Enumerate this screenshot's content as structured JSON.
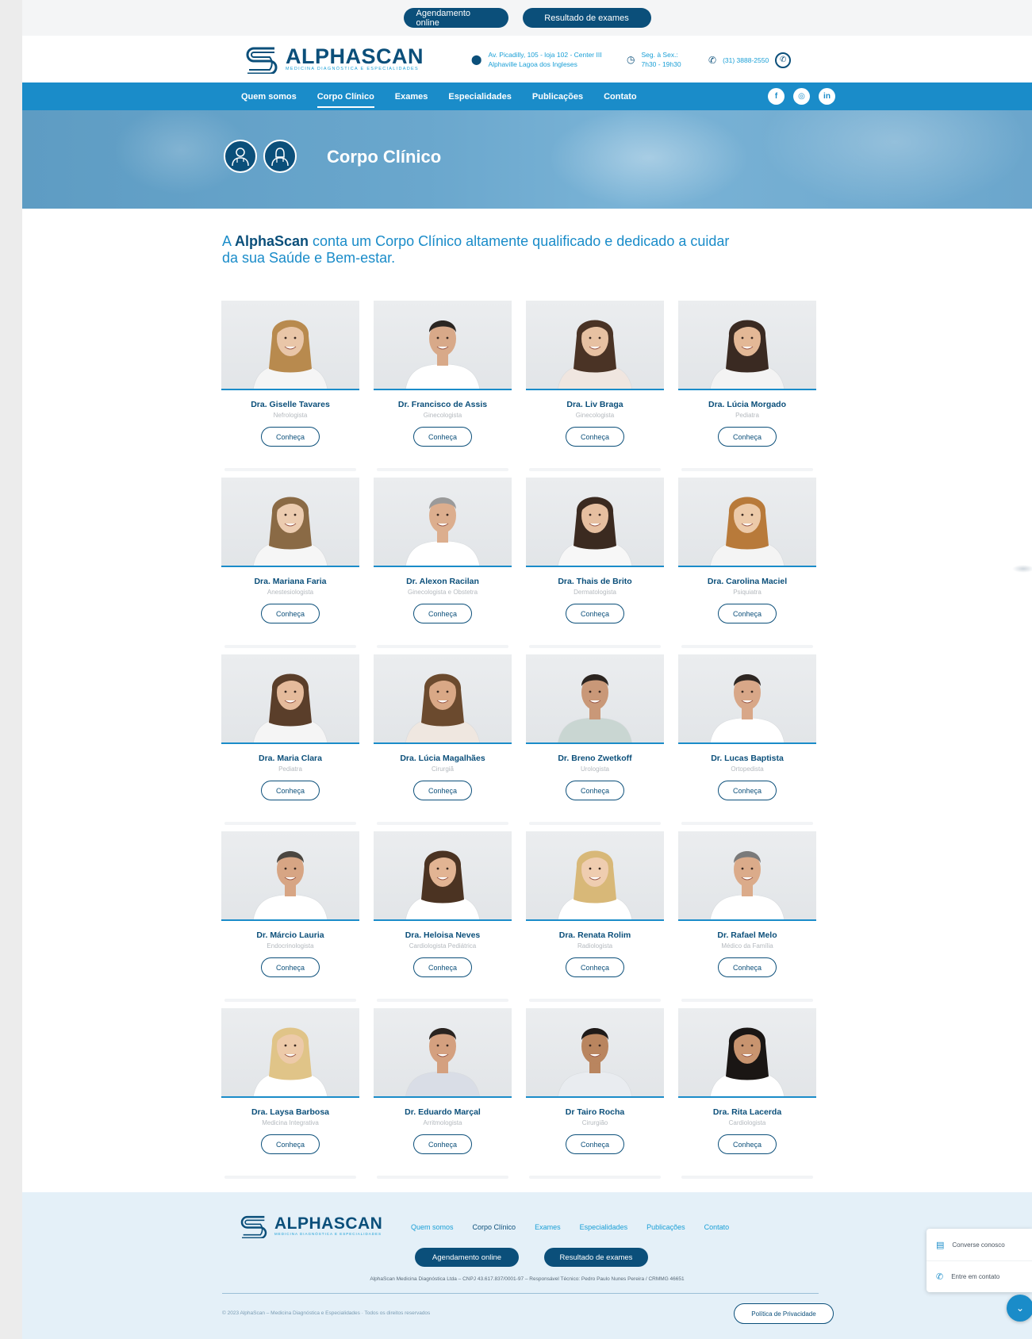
{
  "topbar": {
    "btn_schedule": "Agendamento online",
    "btn_results": "Resultado de exames"
  },
  "header": {
    "brand": "ALPHASCAN",
    "tagline": "MEDICINA DIAGNÓSTICA E ESPECIALIDADES",
    "address_line1": "Av. Picadilly, 105 - loja 102 - Center III",
    "address_line2": "Alphaville Lagoa dos Ingleses",
    "hours_line1": "Seg. à Sex.:",
    "hours_line2": "7h30 - 19h30",
    "phone": "(31) 3888-2550",
    "whatsapp_icon": "whatsapp-icon"
  },
  "nav": {
    "items": [
      "Quem somos",
      "Corpo Clínico",
      "Exames",
      "Especialidades",
      "Publicações",
      "Contato"
    ],
    "active": "Corpo Clínico",
    "socials": [
      "facebook-icon",
      "instagram-icon",
      "linkedin-icon"
    ]
  },
  "hero": {
    "title": "Corpo Clínico"
  },
  "intro": {
    "brand": "AlphaScan",
    "text": " conta um Corpo Clínico altamente qualificado e dedicado a cuidar da sua Saúde e Bem-estar.",
    "prefix": "A "
  },
  "doctors": [
    {
      "name": "Dra. Giselle Tavares",
      "specialty": "Nefrologista",
      "button": "Conheça"
    },
    {
      "name": "Dr. Francisco de Assis",
      "specialty": "Ginecologista",
      "button": "Conheça"
    },
    {
      "name": "Dra. Liv Braga",
      "specialty": "Ginecologista",
      "button": "Conheça"
    },
    {
      "name": "Dra. Lúcia Morgado",
      "specialty": "Pediatra",
      "button": "Conheça"
    },
    {
      "name": "Dra. Mariana Faria",
      "specialty": "Anestesiologista",
      "button": "Conheça"
    },
    {
      "name": "Dr. Alexon Racilan",
      "specialty": "Ginecologista e Obstetra",
      "button": "Conheça"
    },
    {
      "name": "Dra. Thais de Brito",
      "specialty": "Dermatologista",
      "button": "Conheça"
    },
    {
      "name": "Dra. Carolina Maciel",
      "specialty": "Psiquiatra",
      "button": "Conheça"
    },
    {
      "name": "Dra. Maria Clara",
      "specialty": "Pediatra",
      "button": "Conheça"
    },
    {
      "name": "Dra. Lúcia Magalhães",
      "specialty": "Cirurgiã",
      "button": "Conheça"
    },
    {
      "name": "Dr. Breno Zwetkoff",
      "specialty": "Urologista",
      "button": "Conheça"
    },
    {
      "name": "Dr. Lucas Baptista",
      "specialty": "Ortopedista",
      "button": "Conheça"
    },
    {
      "name": "Dr. Márcio Lauria",
      "specialty": "Endocrinologista",
      "button": "Conheça"
    },
    {
      "name": "Dra. Heloisa Neves",
      "specialty": "Cardiologista Pediátrica",
      "button": "Conheça"
    },
    {
      "name": "Dra. Renata Rolim",
      "specialty": "Radiologista",
      "button": "Conheça"
    },
    {
      "name": "Dr. Rafael Melo",
      "specialty": "Médico da Família",
      "button": "Conheça"
    },
    {
      "name": "Dra. Laysa Barbosa",
      "specialty": "Medicina Integrativa",
      "button": "Conheça"
    },
    {
      "name": "Dr. Eduardo Marçal",
      "specialty": "Arritmologista",
      "button": "Conheça"
    },
    {
      "name": "Dr Tairo Rocha",
      "specialty": "Cirurgião",
      "button": "Conheça"
    },
    {
      "name": "Dra. Rita Lacerda",
      "specialty": "Cardiologista",
      "button": "Conheça"
    }
  ],
  "footer": {
    "brand": "ALPHASCAN",
    "tagline": "MEDICINA DIAGNÓSTICA E ESPECIALIDADES",
    "links": [
      "Quem somos",
      "Corpo Clínico",
      "Exames",
      "Especialidades",
      "Publicações",
      "Contato"
    ],
    "btn_schedule": "Agendamento online",
    "btn_results": "Resultado de exames",
    "legal": "AlphaScan Medicina Diagnóstica Ltda – CNPJ 43.617.837/0001-97 – Responsável Técnico: Pedro Paulo Nunes Pereira / CRMMG 46651",
    "copyright": "© 2023 AlphaScan – Medicina Diagnóstica e Especialidades · Todos os direitos reservados",
    "privacy": "Política de Privacidade"
  },
  "chat": {
    "talk": "Converse conosco",
    "contact": "Entre em contato"
  },
  "colors": {
    "primary_dark": "#0b4f7a",
    "primary": "#1a8cc9",
    "accent": "#1a9fd6"
  }
}
